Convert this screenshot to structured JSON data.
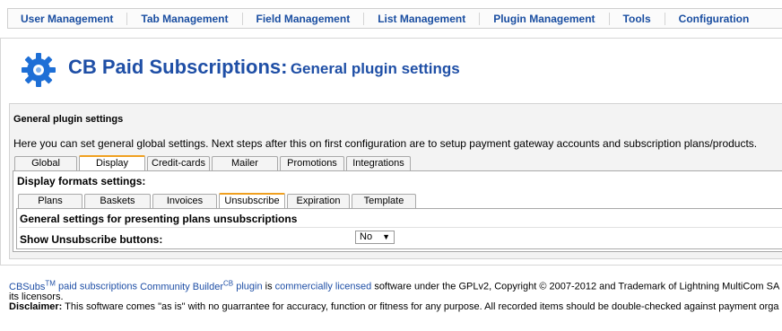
{
  "menu": {
    "items": [
      "User Management",
      "Tab Management",
      "Field Management",
      "List Management",
      "Plugin Management",
      "Tools",
      "Configuration"
    ]
  },
  "header": {
    "title_main": "CB Paid Subscriptions:",
    "title_sub": "General plugin settings",
    "icon": "gear-icon",
    "icon_color": "#1e6fd6"
  },
  "section": {
    "title": "General plugin settings",
    "intro": "Here you can set general global settings. Next steps after this on first configuration are to setup payment gateway accounts and subscription plans/products."
  },
  "main_tabs": {
    "items": [
      "Global",
      "Display",
      "Credit-cards",
      "Mailer",
      "Promotions",
      "Integrations"
    ],
    "active": "Display"
  },
  "display": {
    "title": "Display formats settings:"
  },
  "sub_tabs": {
    "items": [
      "Plans",
      "Baskets",
      "Invoices",
      "Unsubscribe",
      "Expiration",
      "Template"
    ],
    "active": "Unsubscribe"
  },
  "unsubscribe": {
    "title": "General settings for presenting plans unsubscriptions",
    "field_label": "Show Unsubscribe buttons:",
    "field_value": "No"
  },
  "footer": {
    "cbsubs": "CBSubs",
    "tm": "TM",
    "link1": "paid subscriptions",
    "link2": "Community Builder",
    "cb_sup": "CB",
    "link3": "plugin",
    "is": "is",
    "link4": "commercially licensed",
    "license_text": "software under the GPLv2, Copyright © 2007-2012 and Trademark of Lightning MultiCom SA",
    "line2": "its licensors.",
    "disclaimer_label": "Disclaimer:",
    "disclaimer_text": "This software comes \"as is\" with no guarrantee for accuracy, function or fitness for any purpose. All recorded items should be double-checked against payment orga"
  },
  "colors": {
    "link": "#1f4fa6",
    "active_tab_accent": "#f0a020"
  }
}
